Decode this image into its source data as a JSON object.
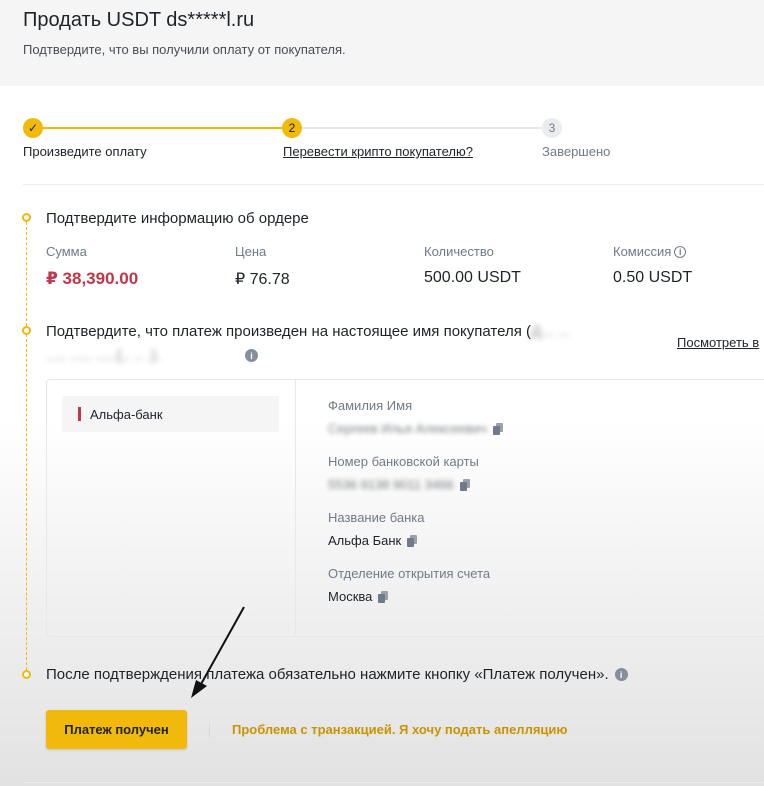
{
  "header": {
    "title": "Продать USDT ds*****l.ru",
    "subtitle": "Подтвердите, что вы получили оплату от покупателя."
  },
  "stepper": {
    "steps": [
      {
        "number": "✓",
        "label": "Произведите оплату",
        "state": "done"
      },
      {
        "number": "2",
        "label": "Перевести крипто покупателю?",
        "state": "active"
      },
      {
        "number": "3",
        "label": "Завершено",
        "state": "todo"
      }
    ]
  },
  "order_info": {
    "title": "Подтвердите информацию об ордере",
    "amount_label": "Сумма",
    "amount_value": "₽ 38,390.00",
    "price_label": "Цена",
    "price_value": "₽ 76.78",
    "quantity_label": "Количество",
    "quantity_value": "500.00 USDT",
    "fee_label": "Комиссия",
    "fee_value": "0.50 USDT"
  },
  "payment_check": {
    "title": "Подтвердите, что платеж произведен на настоящее имя покупателя (",
    "title_blurred": "Д... ...",
    "line2_blurred": "..... ..... .....(.. .. .).",
    "see_link": "Посмотреть в"
  },
  "payment_card": {
    "bank_tab": "Альфа-банк",
    "fields": [
      {
        "label": "Фамилия Имя",
        "value": "Сергеев Илья Алексеевич",
        "blurred": true
      },
      {
        "label": "Номер банковской карты",
        "value": "5536 9138 9011 3466",
        "blurred": true
      },
      {
        "label": "Название банка",
        "value": "Альфа Банк",
        "blurred": false
      },
      {
        "label": "Отделение открытия счета",
        "value": "Москва",
        "blurred": false
      }
    ]
  },
  "final_step": {
    "note": "После подтверждения платежа обязательно нажмите кнопку «Платеж получен».",
    "confirm_button": "Платеж получен",
    "appeal_link": "Проблема с транзакцией. Я хочу подать апелляцию"
  },
  "colors": {
    "accent": "#f0b90b",
    "amount_red": "#c0354a",
    "link_gold": "#c99400"
  }
}
